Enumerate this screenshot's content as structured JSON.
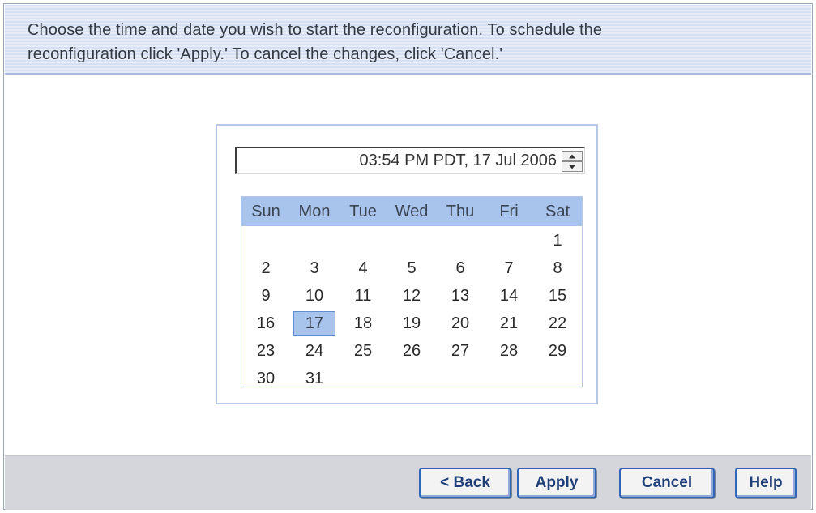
{
  "info": {
    "line1": "Choose the time and date you wish to start the reconfiguration.  To schedule the",
    "line2": "reconfiguration click 'Apply.'  To cancel the changes, click 'Cancel.'"
  },
  "datetime": {
    "value": "03:54 PM PDT, 17 Jul 2006"
  },
  "calendar": {
    "weekdays": [
      "Sun",
      "Mon",
      "Tue",
      "Wed",
      "Thu",
      "Fri",
      "Sat"
    ],
    "first_weekday_index": 6,
    "days_in_month": 31,
    "selected_day": 17,
    "selected_color": "#a9c4ec"
  },
  "buttons": {
    "back": "< Back",
    "apply": "Apply",
    "cancel": "Cancel",
    "help": "Help"
  }
}
